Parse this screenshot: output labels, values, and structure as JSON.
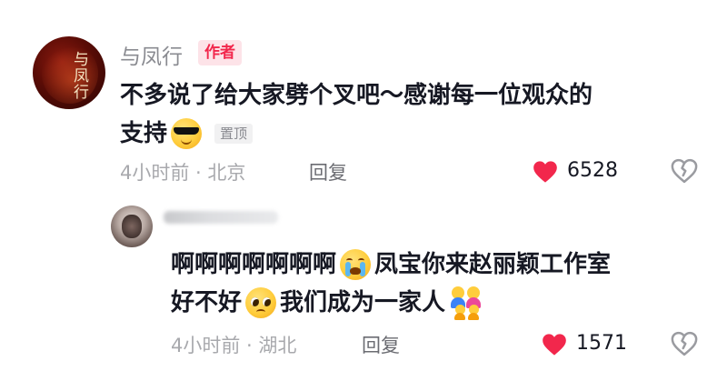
{
  "comments": [
    {
      "username": "与凤行",
      "author_badge": "作者",
      "avatar_text": "与凤行",
      "text_line1": "不多说了给大家劈个叉吧～感谢每一位观众的",
      "text_line2": "支持",
      "emoji": "cool-sunglasses-emoji",
      "pinned_label": "置顶",
      "time": "4小时前 · 北京",
      "reply_label": "回复",
      "likes": "6528",
      "liked": true
    },
    {
      "username": "",
      "text_line1_a": "啊啊啊啊啊啊啊",
      "text_line1_b": "凤宝你来赵丽颖工作室",
      "text_line2_a": "好不好",
      "text_line2_b": "我们成为一家人",
      "emojis": [
        "crying-emoji",
        "pleading-emoji",
        "family-emoji"
      ],
      "time": "4小时前 · 湖北",
      "reply_label": "回复",
      "likes": "1571",
      "liked": true
    }
  ],
  "colors": {
    "like_red": "#f2274c",
    "meta_gray": "#a8a9ad",
    "text_dark": "#161823"
  }
}
